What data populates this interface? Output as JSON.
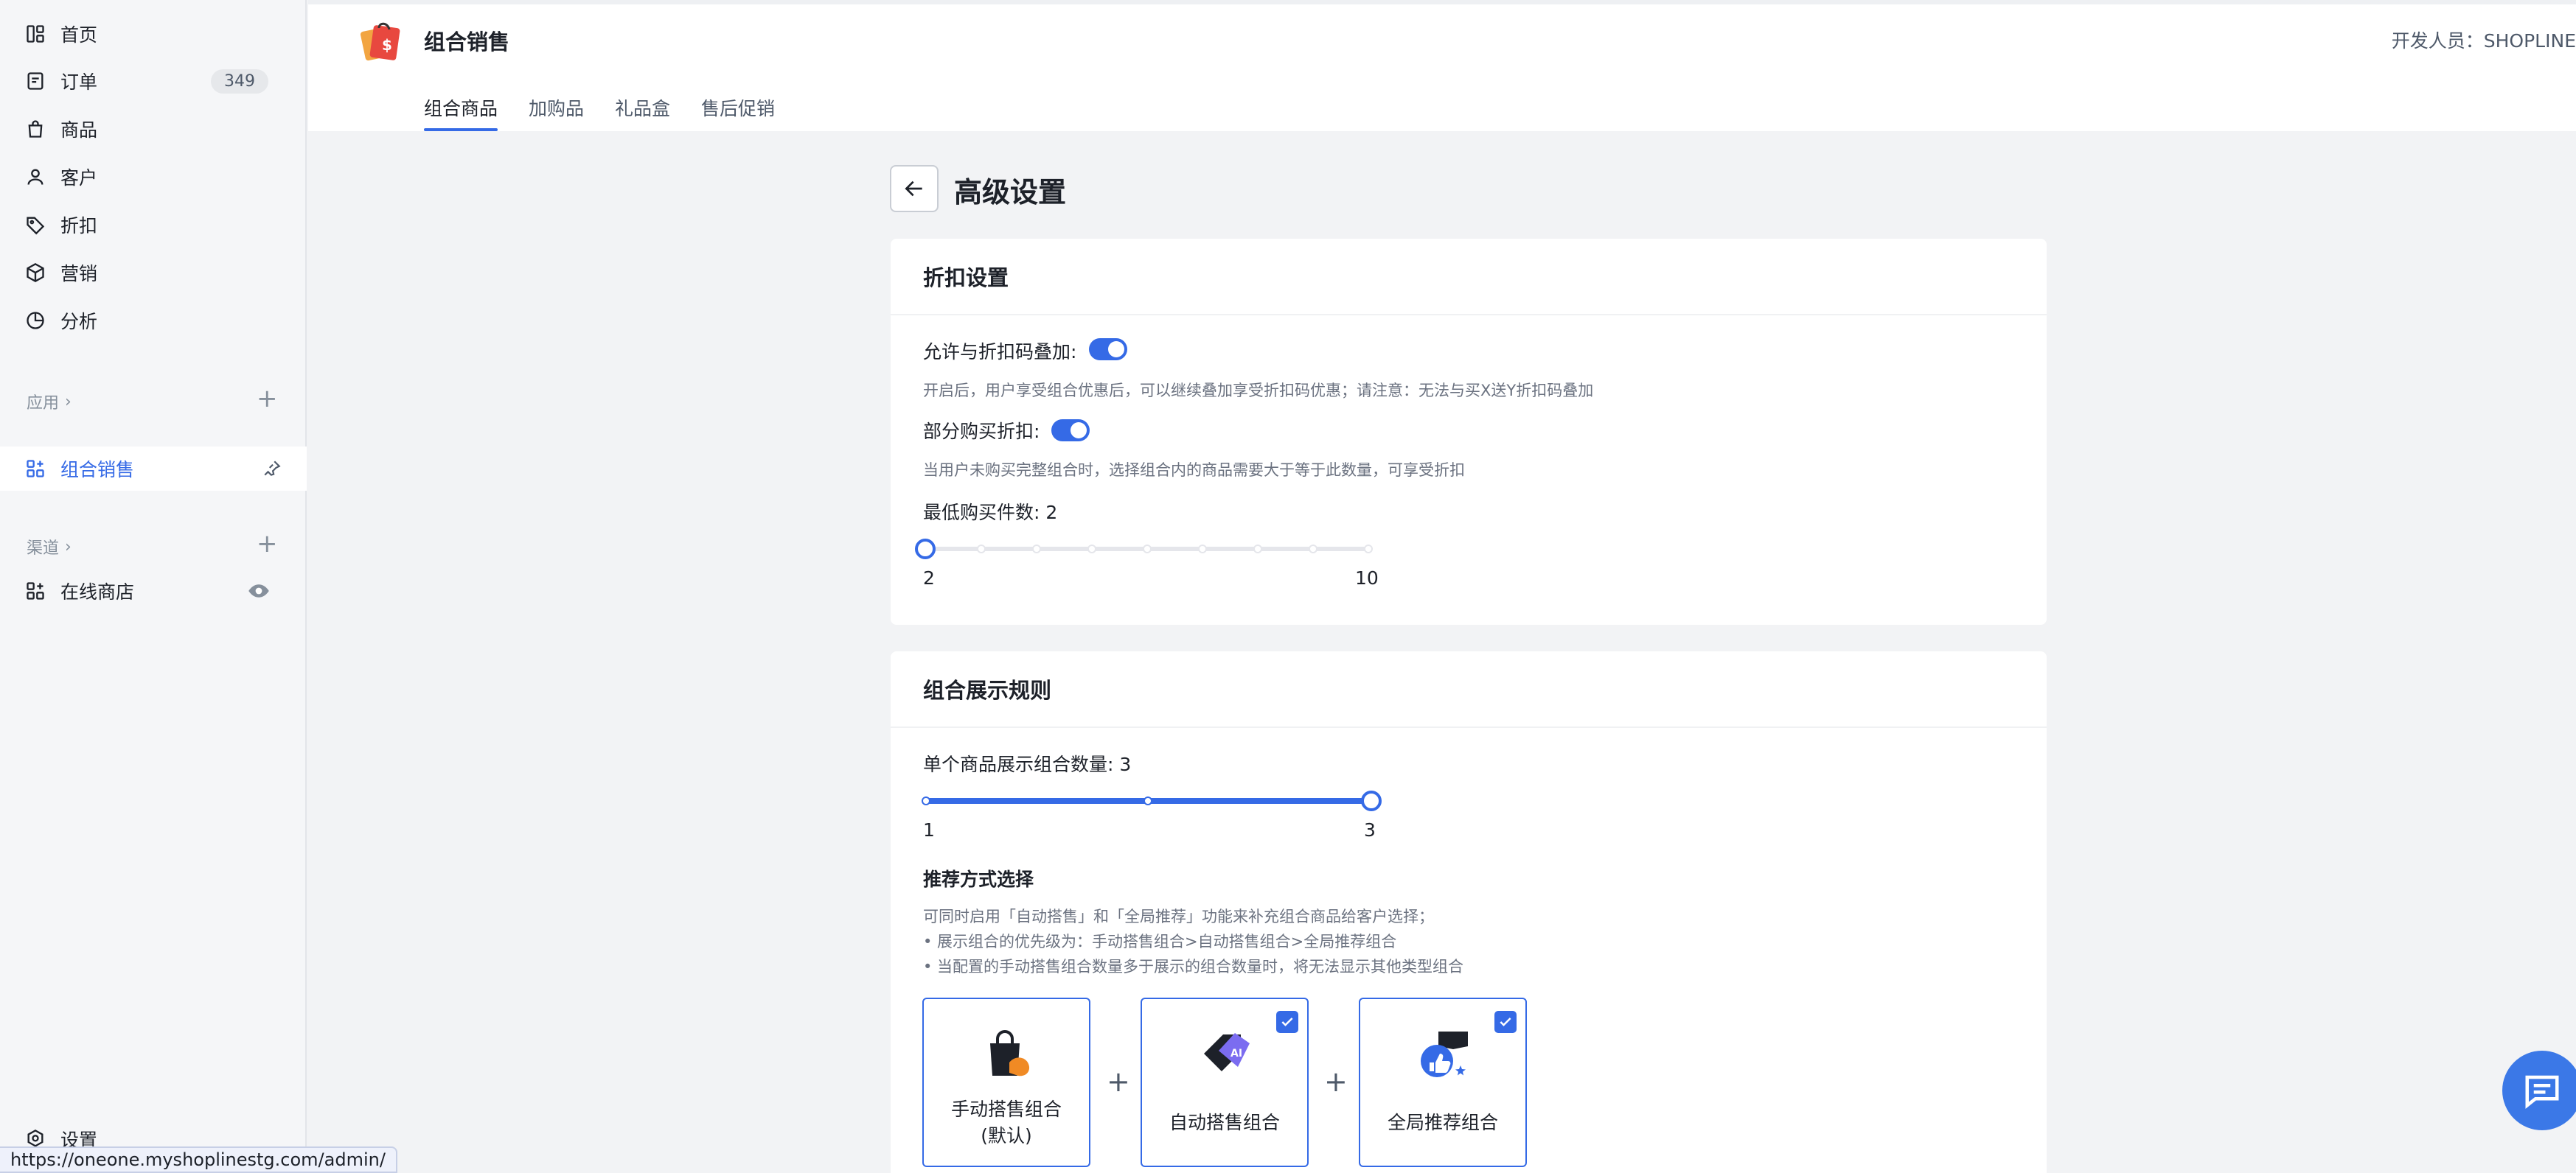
{
  "sidebar": {
    "items": [
      {
        "label": "首页",
        "icon": "dashboard-icon"
      },
      {
        "label": "订单",
        "icon": "order-icon",
        "badge": "349"
      },
      {
        "label": "商品",
        "icon": "bag-icon"
      },
      {
        "label": "客户",
        "icon": "user-icon"
      },
      {
        "label": "折扣",
        "icon": "tag-icon"
      },
      {
        "label": "营销",
        "icon": "cube-icon"
      },
      {
        "label": "分析",
        "icon": "pie-icon"
      }
    ],
    "apps_label": "应用",
    "active_app": "组合销售",
    "channels_label": "渠道",
    "channel_store": "在线商店",
    "settings_label": "设置"
  },
  "header": {
    "app_title": "组合销售",
    "developer": "开发人员：SHOPLINE",
    "tabs": [
      "组合商品",
      "加购品",
      "礼品盒",
      "售后促销"
    ]
  },
  "page": {
    "title": "高级设置"
  },
  "discount_card": {
    "title": "折扣设置",
    "stack_label": "允许与折扣码叠加:",
    "stack_hint": "开启后，用户享受组合优惠后，可以继续叠加享受折扣码优惠；请注意：无法与买X送Y折扣码叠加",
    "stack_enabled": true,
    "partial_label": "部分购买折扣:",
    "partial_hint": "当用户未购买完整组合时，选择组合内的商品需要大于等于此数量，可享受折扣",
    "partial_enabled": true,
    "min_label": "最低购买件数: 2",
    "min_slider": {
      "min": "2",
      "max": "10",
      "value": 2
    }
  },
  "display_card": {
    "title": "组合展示规则",
    "count_label": "单个商品展示组合数量: 3",
    "count_slider": {
      "min": "1",
      "max": "3",
      "value": 3
    },
    "rec_title": "推荐方式选择",
    "rec_hint_1": "可同时启用「自动搭售」和「全局推荐」功能来补充组合商品给客户选择；",
    "rec_hint_2": "• 展示组合的优先级为：手动搭售组合>自动搭售组合>全局推荐组合",
    "rec_hint_3": "• 当配置的手动搭售组合数量多于展示的组合数量时，将无法显示其他类型组合",
    "options": [
      {
        "label": "手动搭售组合",
        "sub": "(默认)",
        "checked": false
      },
      {
        "label": "自动搭售组合",
        "checked": true
      },
      {
        "label": "全局推荐组合",
        "checked": true
      }
    ],
    "plus": "+"
  },
  "status_url": "https://oneone.myshoplinestg.com/admin/",
  "colors": {
    "accent": "#356ae6"
  }
}
